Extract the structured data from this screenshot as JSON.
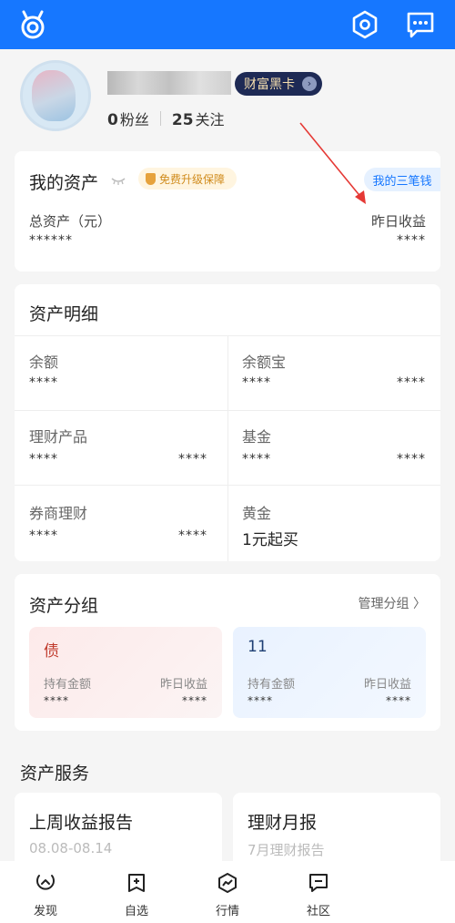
{
  "header": {
    "logo_icon": "alipay-mascot-icon",
    "settings_icon": "hexagon-settings-icon",
    "message_icon": "chat-bubble-icon",
    "accent_color": "#1677ff"
  },
  "profile": {
    "vip_label": "财富黑卡",
    "fans_count": "0",
    "fans_label": "粉丝",
    "follow_count": "25",
    "follow_label": "关注"
  },
  "my_assets": {
    "title": "我的资产",
    "upgrade_badge": "免费升级保障",
    "three_money": "我的三笔钱",
    "total_label": "总资产（元）",
    "total_value": "******",
    "yesterday_label": "昨日收益",
    "yesterday_value": "****"
  },
  "details": {
    "title": "资产明细",
    "cells": [
      {
        "label": "余额",
        "value": "****",
        "extra": ""
      },
      {
        "label": "余额宝",
        "value": "****",
        "extra": "****"
      },
      {
        "label": "理财产品",
        "value": "****",
        "extra": "****"
      },
      {
        "label": "基金",
        "value": "****",
        "extra": "****"
      },
      {
        "label": "券商理财",
        "value": "****",
        "extra": "****"
      },
      {
        "label": "黄金",
        "value": "1元起买",
        "extra": ""
      }
    ]
  },
  "groups": {
    "title": "资产分组",
    "manage": "管理分组 〉",
    "items": [
      {
        "name": "债",
        "hold_label": "持有金额",
        "hold_value": "****",
        "yest_label": "昨日收益",
        "yest_value": "****"
      },
      {
        "name": "11",
        "hold_label": "持有金额",
        "hold_value": "****",
        "yest_label": "昨日收益",
        "yest_value": "****"
      }
    ]
  },
  "services": {
    "title": "资产服务",
    "items": [
      {
        "title": "上周收益报告",
        "subtitle": "08.08-08.14"
      },
      {
        "title": "理财月报",
        "subtitle": "7月理财报告"
      }
    ]
  },
  "tabbar": {
    "items": [
      {
        "label": "发现",
        "icon": "discover-icon"
      },
      {
        "label": "自选",
        "icon": "watchlist-add-icon"
      },
      {
        "label": "行情",
        "icon": "market-trend-icon"
      },
      {
        "label": "社区",
        "icon": "community-chat-icon"
      }
    ]
  }
}
